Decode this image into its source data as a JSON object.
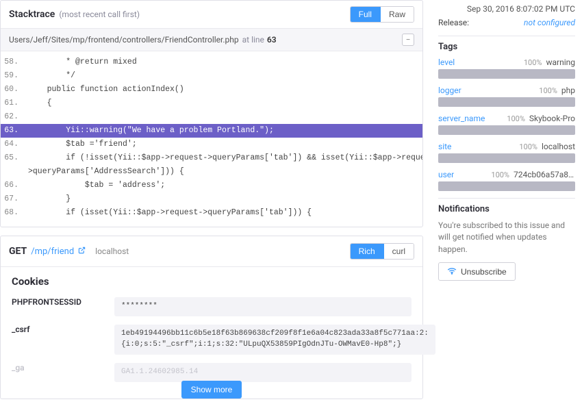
{
  "stacktrace": {
    "title": "Stacktrace",
    "subtitle": "(most recent call first)",
    "btn_full": "Full",
    "btn_raw": "Raw",
    "file": "Users/Jeff/Sites/mp/frontend/controllers/FriendController.php",
    "at_line_label": "at line",
    "at_line": "63",
    "collapse": "−",
    "lines": [
      {
        "n": "58.",
        "t": "        * @return mixed"
      },
      {
        "n": "59.",
        "t": "        */"
      },
      {
        "n": "60.",
        "t": "    public function actionIndex()"
      },
      {
        "n": "61.",
        "t": "    {"
      },
      {
        "n": "62.",
        "t": ""
      },
      {
        "n": "63.",
        "t": "        Yii::warning(\"We have a problem Portland.\");",
        "hl": true
      },
      {
        "n": "64.",
        "t": "        $tab ='friend';"
      },
      {
        "n": "65.",
        "t": "        if (!isset(Yii::$app->request->queryParams['tab']) && isset(Yii::$app->request->"
      },
      {
        "n": "",
        "t": ">queryParams['AddressSearch'])) {"
      },
      {
        "n": "66.",
        "t": "            $tab = 'address';"
      },
      {
        "n": "67.",
        "t": "        }"
      },
      {
        "n": "68.",
        "t": "        if (isset(Yii::$app->request->queryParams['tab'])) {"
      }
    ]
  },
  "request": {
    "method": "GET",
    "path": "/mp/friend",
    "host": "localhost",
    "btn_rich": "Rich",
    "btn_curl": "curl",
    "cookies_title": "Cookies",
    "cookies": [
      {
        "k": "PHPFRONTSESSID",
        "v": "********"
      },
      {
        "k": "_csrf",
        "v": "1eb49194496bb11c6b5e18f63b869638cf209f8f1e6a04c823ada33a8f5c771aa:2:{i:0;s:5:\"_csrf\";i:1;s:32:\"ULpuQX53859PIgOdnJTu-OWMavE0-Hp8\";}"
      },
      {
        "k": "_ga",
        "v": "GA1.1.24602985.14",
        "fade": true
      }
    ],
    "show_more": "Show more"
  },
  "sidebar": {
    "timestamp": "Sep 30, 2016 8:07:02 PM UTC",
    "release_label": "Release:",
    "release_value": "not configured",
    "tags_title": "Tags",
    "tags": [
      {
        "name": "level",
        "pct": "100%",
        "val": "warning"
      },
      {
        "name": "logger",
        "pct": "100%",
        "val": "php"
      },
      {
        "name": "server_name",
        "pct": "100%",
        "val": "Skybook-Pro"
      },
      {
        "name": "site",
        "pct": "100%",
        "val": "localhost"
      },
      {
        "name": "user",
        "pct": "100%",
        "val": "724cb06a57a8f..."
      }
    ],
    "notifications_title": "Notifications",
    "notifications_text": "You're subscribed to this issue and will get notified when updates happen.",
    "unsubscribe": "Unsubscribe"
  }
}
